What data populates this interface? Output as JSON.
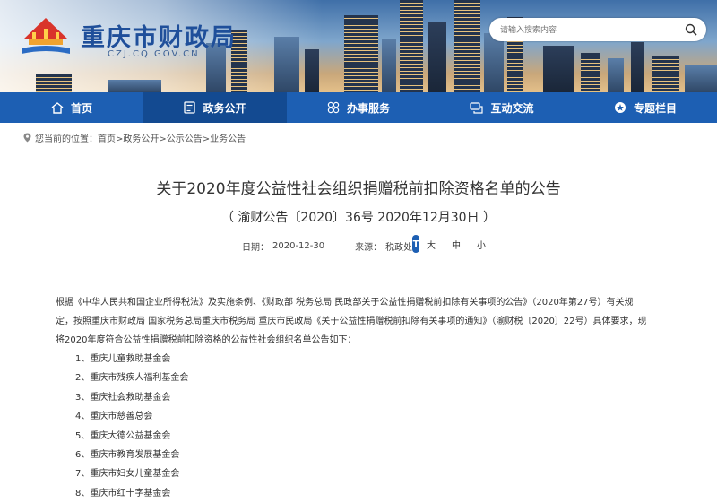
{
  "header": {
    "site_title": "重庆市财政局",
    "site_domain": "CZJ.CQ.GOV.CN",
    "search_placeholder": "请输入搜索内容"
  },
  "nav": {
    "items": [
      {
        "label": "首页",
        "icon": "home-icon"
      },
      {
        "label": "政务公开",
        "icon": "document-icon",
        "active": true
      },
      {
        "label": "办事服务",
        "icon": "service-icon"
      },
      {
        "label": "互动交流",
        "icon": "chat-icon"
      },
      {
        "label": "专题栏目",
        "icon": "star-icon"
      }
    ]
  },
  "breadcrumb": {
    "prefix": "您当前的位置：",
    "path": "首页>政务公开>公示公告>业务公告"
  },
  "article": {
    "title": "关于2020年度公益性社会组织捐赠税前扣除资格名单的公告",
    "doc_number": "（ 渝财公告〔2020〕36号 2020年12月30日 ）",
    "date_label": "日期：",
    "date": "2020-12-30",
    "source_label": "来源：",
    "source": "税政处",
    "font_sizes": [
      "大",
      "中",
      "小"
    ],
    "body_lines": [
      "根据《中华人民共和国企业所得税法》及实施条例、《财政部 税务总局 民政部关于公益性捐赠税前扣除有关事项的公告》（2020年第27号）有关规",
      "定，按照重庆市财政局 国家税务总局重庆市税务局 重庆市民政局《关于公益性捐赠税前扣除有关事项的通知》（渝财税〔2020〕22号）具体要求，现",
      "将2020年度符合公益性捐赠税前扣除资格的公益性社会组织名单公告如下："
    ],
    "list": [
      "1、重庆儿童救助基金会",
      "2、重庆市残疾人福利基金会",
      "3、重庆社会救助基金会",
      "4、重庆市慈善总会",
      "5、重庆大德公益基金会",
      "6、重庆市教育发展基金会",
      "7、重庆市妇女儿童基金会",
      "8、重庆市红十字基金会"
    ]
  },
  "colors": {
    "nav_bg": "#1d5fb3",
    "nav_active": "#134a91",
    "brand_title": "#1f4f9a"
  }
}
